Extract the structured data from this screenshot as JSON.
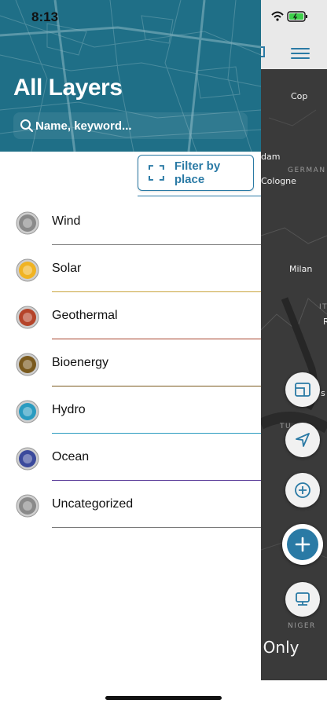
{
  "status_bar": {
    "time": "8:13"
  },
  "drawer": {
    "title": "All Layers",
    "search_placeholder": "Name, keyword...",
    "filter_label": "Filter by place",
    "layers": [
      {
        "label": "Wind",
        "icon": "wind-icon",
        "color": "#8a8a8a",
        "rule": "#7a7a7a"
      },
      {
        "label": "Solar",
        "icon": "sun-icon",
        "color": "#f0b323",
        "rule": "#c9a43c"
      },
      {
        "label": "Geothermal",
        "icon": "volcano-icon",
        "color": "#b5442a",
        "rule": "#a8432b"
      },
      {
        "label": "Bioenergy",
        "icon": "leaf-drop-icon",
        "color": "#7a5a1e",
        "rule": "#7a5a1e"
      },
      {
        "label": "Hydro",
        "icon": "water-drop-icon",
        "color": "#2a9bc0",
        "rule": "#2a9bc0"
      },
      {
        "label": "Ocean",
        "icon": "wave-icon",
        "color": "#3b4a9c",
        "rule": "#5a3d9a"
      },
      {
        "label": "Uncategorized",
        "icon": "question-globe-icon",
        "color": "#8a8a8a",
        "rule": "#7a7a7a"
      }
    ]
  },
  "map": {
    "labels": {
      "cop": "Cop",
      "dam": "dam",
      "germany": "GERMAN",
      "cologne": "Cologne",
      "milan": "Milan",
      "it": "IT",
      "r": "R",
      "s": "s",
      "tu": "TU",
      "niger": "NIGER"
    },
    "note": "e Only"
  },
  "colors": {
    "accent": "#2a7aa5",
    "header": "#1f6f87"
  }
}
